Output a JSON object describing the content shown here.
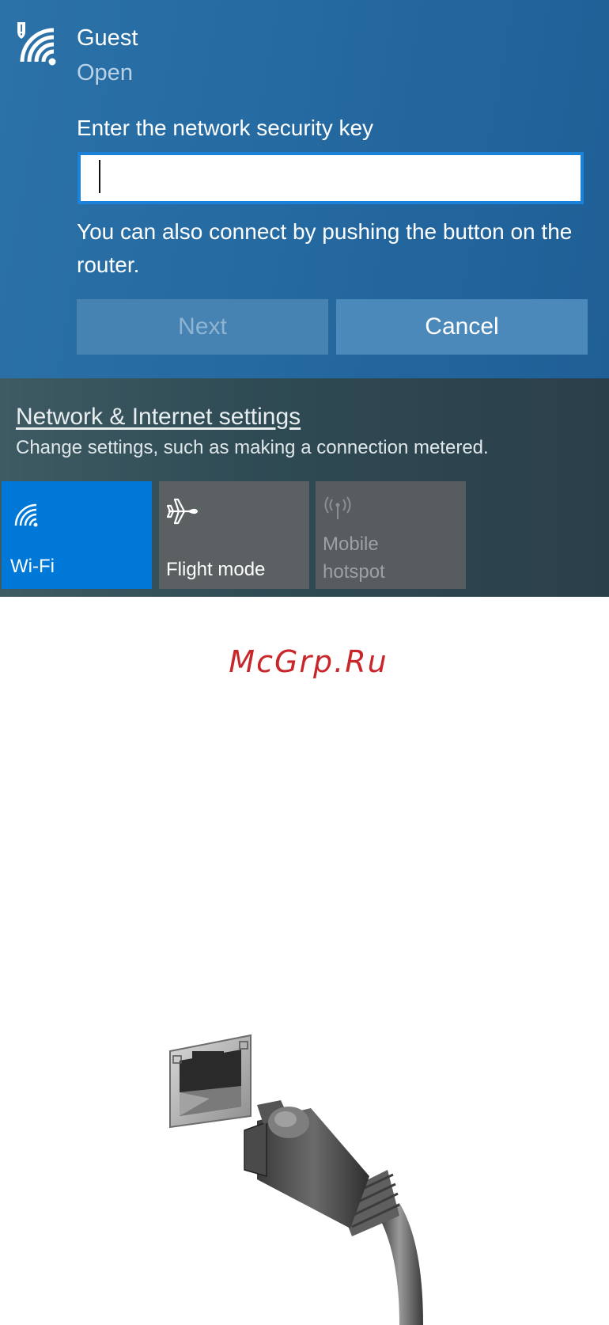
{
  "network": {
    "name": "Guest",
    "status": "Open",
    "icon": "wifi-secured-icon"
  },
  "security_key": {
    "label": "Enter the network security key",
    "value": "",
    "placeholder": ""
  },
  "router_hint": "You can also connect by pushing the button on the router.",
  "buttons": {
    "next": "Next",
    "cancel": "Cancel"
  },
  "settings": {
    "link": "Network & Internet settings",
    "description": "Change settings, such as making a connection metered."
  },
  "quick_actions": [
    {
      "label": "Wi-Fi",
      "icon": "wifi-icon",
      "state": "on"
    },
    {
      "label": "Flight mode",
      "icon": "airplane-icon",
      "state": "off"
    },
    {
      "label_line1": "Mobile",
      "label_line2": "hotspot",
      "icon": "mobile-hotspot-icon",
      "state": "disabled"
    }
  ],
  "watermark": "McGrp.Ru",
  "illustration": "ethernet-cable-and-port",
  "colors": {
    "accent": "#0078d7",
    "panel_blue": "#256aa1",
    "watermark_red": "#c8262a"
  }
}
